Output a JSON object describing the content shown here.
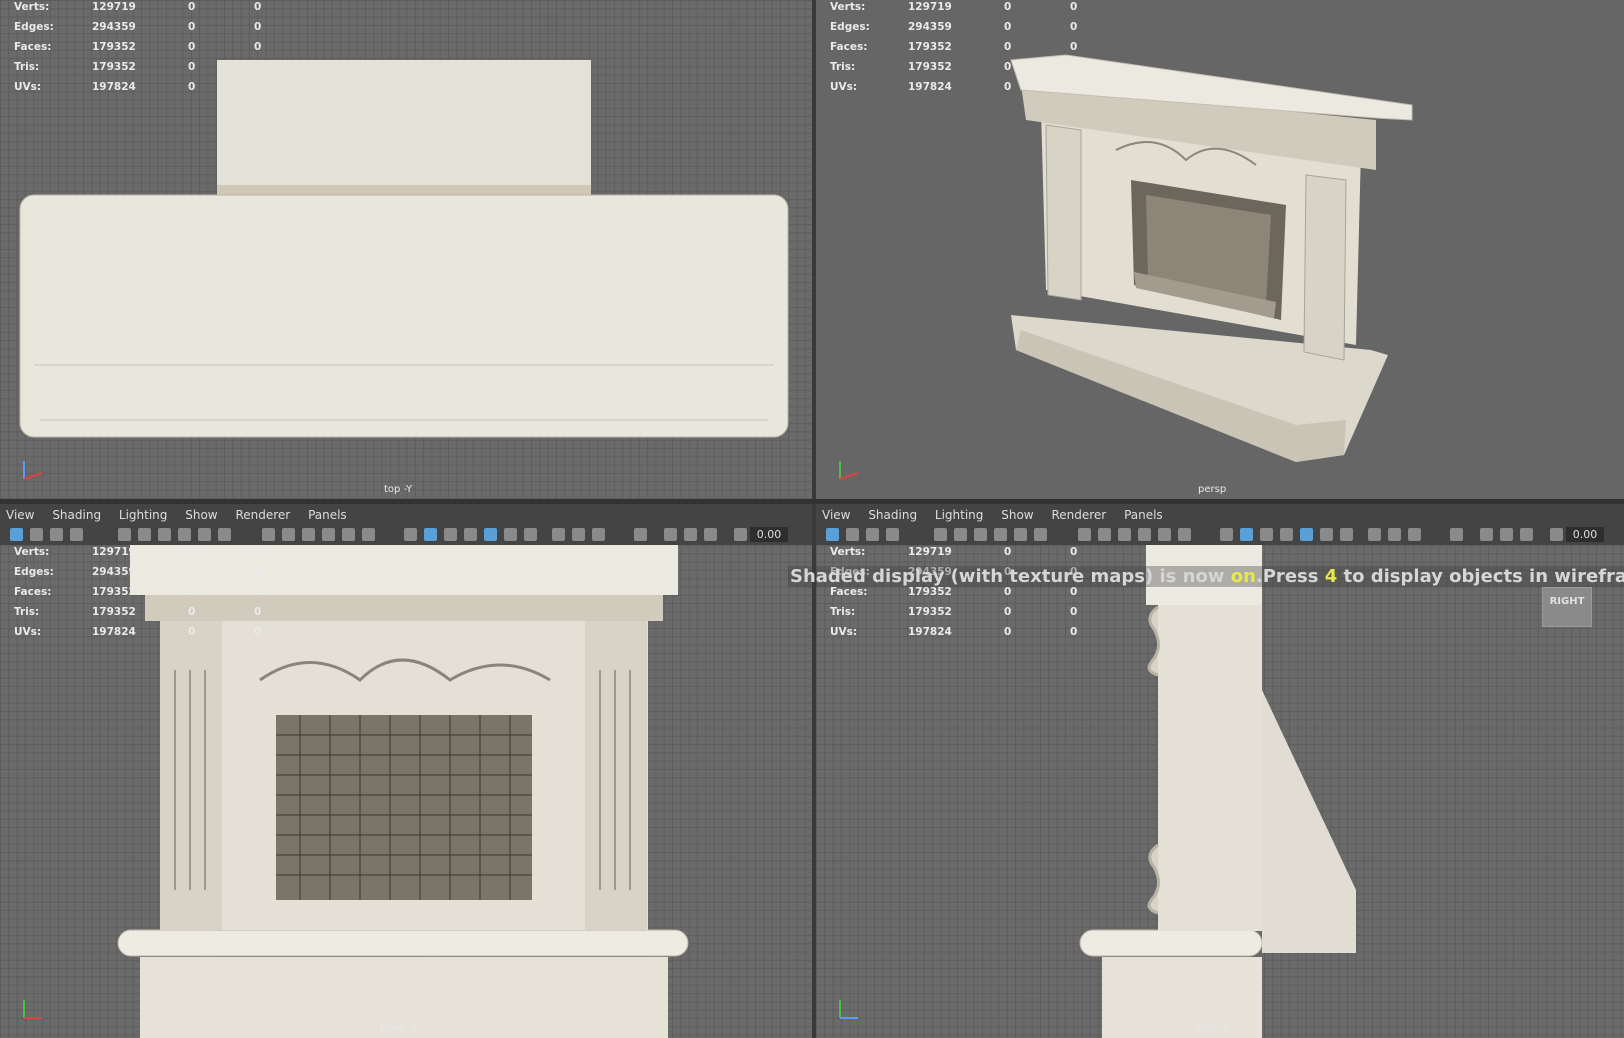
{
  "hud": {
    "rows": [
      {
        "label": "Verts:",
        "v1": "129719",
        "v2": "0",
        "v3": "0"
      },
      {
        "label": "Edges:",
        "v1": "294359",
        "v2": "0",
        "v3": "0"
      },
      {
        "label": "Faces:",
        "v1": "179352",
        "v2": "0",
        "v3": "0"
      },
      {
        "label": "Tris:",
        "v1": "179352",
        "v2": "0",
        "v3": "0"
      },
      {
        "label": "UVs:",
        "v1": "197824",
        "v2": "0",
        "v3": "0"
      }
    ]
  },
  "viewports": {
    "top": {
      "camera": "top -Y"
    },
    "persp": {
      "camera": "persp"
    },
    "front": {
      "camera": "front -Z"
    },
    "side": {
      "camera": "side -X"
    }
  },
  "menus": [
    "View",
    "Shading",
    "Lighting",
    "Show",
    "Renderer",
    "Panels"
  ],
  "toolbar": {
    "value": "0.00"
  },
  "message": {
    "part1": "Shaded display (with texture maps) is now ",
    "on": "on",
    "part2": ".Press ",
    "key": "4",
    "part3": " to display objects in wireframe mo"
  },
  "view_cube": {
    "label": "RIGHT"
  },
  "colors": {
    "viewport_bg": "#6a6a6a",
    "grid": "#5d5d5d",
    "highlight": "#e8e84a",
    "marble": "#e9e6dc"
  }
}
